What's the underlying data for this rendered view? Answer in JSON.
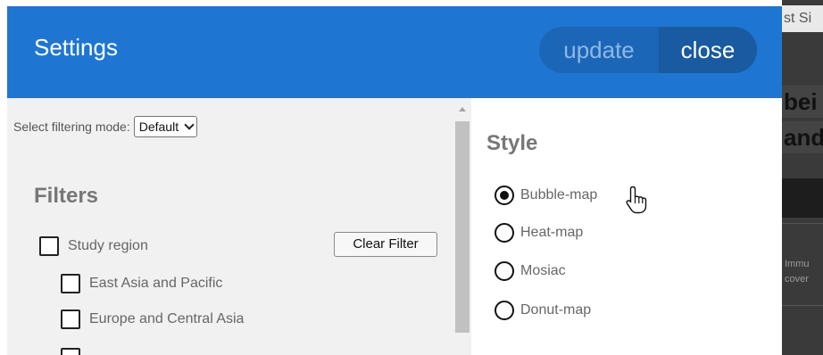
{
  "background_page": {
    "tab_text": "st Si",
    "heading_line_1": "bei",
    "heading_line_2": "and",
    "small_line_1": "Immu",
    "small_line_2": "cover"
  },
  "dialog": {
    "title": "Settings",
    "update_label": "update",
    "close_label": "close"
  },
  "left_pane": {
    "mode_label": "Select filtering mode:",
    "mode_value": "Default",
    "filters_title": "Filters",
    "clear_filter_label": "Clear Filter",
    "filter_items": [
      {
        "label": "Study region",
        "checked": false
      },
      {
        "label": "East Asia and Pacific",
        "checked": false
      },
      {
        "label": "Europe and Central Asia",
        "checked": false
      }
    ]
  },
  "right_pane": {
    "style_title": "Style",
    "options": [
      {
        "label": "Bubble-map",
        "selected": true
      },
      {
        "label": "Heat-map",
        "selected": false
      },
      {
        "label": "Mosiac",
        "selected": false
      },
      {
        "label": "Donut-map",
        "selected": false
      }
    ]
  },
  "icons": {
    "pointer": "hand-pointer-icon",
    "select_arrow": "chevron-down-icon",
    "scroll_up": "arrow-up-icon"
  },
  "colors": {
    "header": "#1f76d2",
    "update_bg": "#1b66b7",
    "close_bg": "#195aa0",
    "left_pane_bg": "#f1f1f1"
  }
}
